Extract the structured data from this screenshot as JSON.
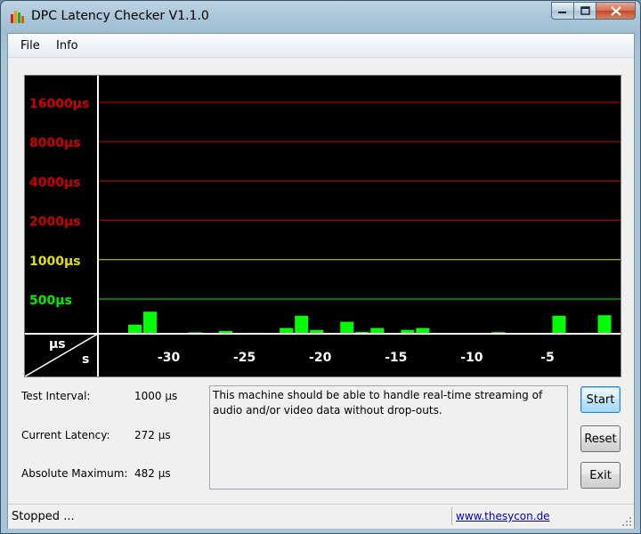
{
  "window": {
    "title": "DPC Latency Checker V1.1.0"
  },
  "menu": {
    "items": [
      "File",
      "Info"
    ]
  },
  "chart_data": {
    "type": "bar",
    "y_scale": "log",
    "y_ticks": [
      "16000µs",
      "8000µs",
      "4000µs",
      "2000µs",
      "1000µs",
      "500µs"
    ],
    "y_tick_values": [
      16000,
      8000,
      4000,
      2000,
      1000,
      500
    ],
    "x_ticks": [
      "-30",
      "-25",
      "-20",
      "-15",
      "-10",
      "-5"
    ],
    "x_tick_values": [
      -30,
      -25,
      -20,
      -15,
      -10,
      -5
    ],
    "y_unit": "µs",
    "x_unit": "s",
    "x_range": [
      -34.5,
      0
    ],
    "grid": true,
    "colors": {
      "bars": "#00ff00",
      "high_lines": "#cc0000",
      "mid_line": "#e0e000",
      "low_line": "#00ee00",
      "background": "#000000"
    },
    "x": [
      -33,
      -32,
      -31,
      -30,
      -29,
      -28,
      -27,
      -26,
      -25,
      -24,
      -23,
      -22,
      -21,
      -20,
      -19,
      -18,
      -17,
      -16,
      -15,
      -14,
      -13,
      -12,
      -11,
      -10,
      -9,
      -8,
      -7,
      -6,
      -5,
      -4,
      -3,
      -2,
      -1,
      0
    ],
    "values": [
      272,
      318,
      400,
      260,
      265,
      278,
      275,
      285,
      272,
      276,
      260,
      300,
      372,
      290,
      272,
      335,
      280,
      300,
      228,
      290,
      300,
      260,
      266,
      255,
      260,
      279,
      245,
      272,
      265,
      372,
      242,
      276,
      376,
      272
    ]
  },
  "info": {
    "test_interval_label": "Test Interval:",
    "test_interval_value": "1000 µs",
    "current_latency_label": "Current Latency:",
    "current_latency_value": "272 µs",
    "absolute_maximum_label": "Absolute Maximum:",
    "absolute_maximum_value": "482 µs"
  },
  "message": "This machine should be able to handle real-time streaming of audio and/or video data without drop-outs.",
  "buttons": {
    "start": "Start",
    "reset": "Reset",
    "exit": "Exit"
  },
  "status": {
    "text": "Stopped ...",
    "link": "www.thesycon.de"
  }
}
